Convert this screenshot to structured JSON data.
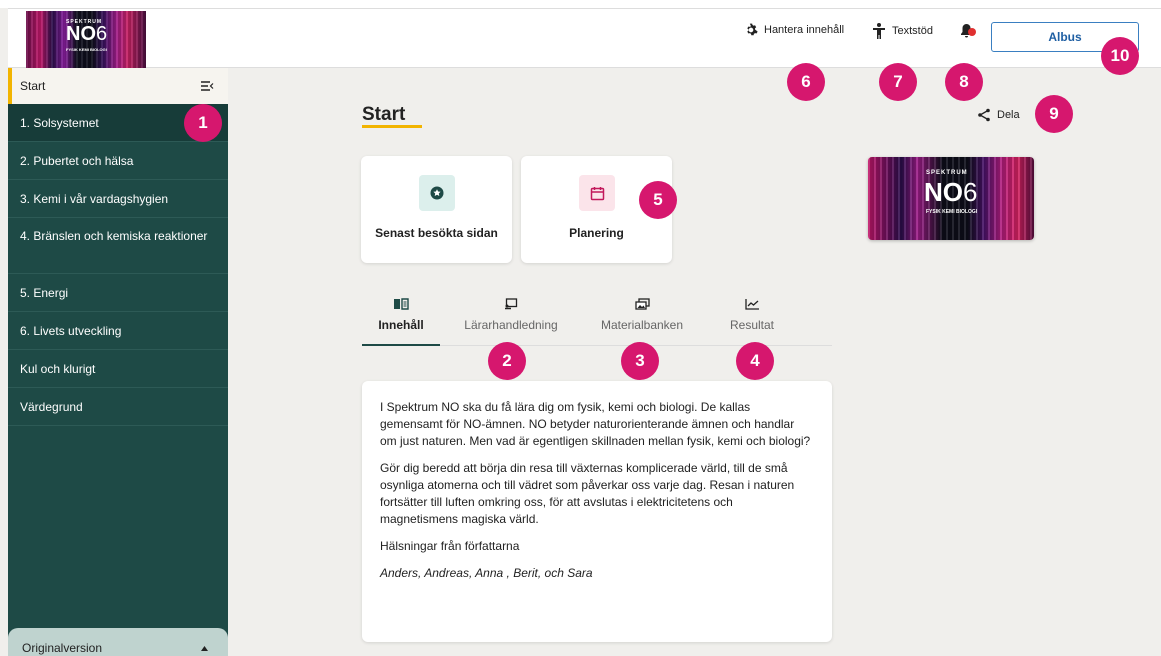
{
  "header": {
    "logo": {
      "small": "SPEKTRUM",
      "big": "NO",
      "num": "6",
      "sub": "FYSIK KEMI BIOLOGI"
    },
    "manage_label": "Hantera innehåll",
    "textsupport_label": "Textstöd",
    "user_label": "Albus"
  },
  "sidebar": {
    "start_label": "Start",
    "items": [
      {
        "label": "1. Solsystemet"
      },
      {
        "label": "2. Pubertet och hälsa"
      },
      {
        "label": "3. Kemi i vår vardagshygien"
      },
      {
        "label": "4. Bränslen och kemiska reaktioner"
      },
      {
        "label": "5. Energi"
      },
      {
        "label": "6. Livets utveckling"
      },
      {
        "label": "Kul och klurigt"
      },
      {
        "label": "Värdegrund"
      }
    ],
    "version_label": "Originalversion"
  },
  "main": {
    "title": "Start",
    "share_label": "Dela",
    "cards": [
      {
        "label": "Senast besökta sidan"
      },
      {
        "label": "Planering"
      }
    ],
    "cover": {
      "small": "SPEKTRUM",
      "big": "NO",
      "num": "6",
      "sub": "FYSIK KEMI BIOLOGI"
    },
    "tabs": [
      {
        "label": "Innehåll"
      },
      {
        "label": "Lärarhandledning"
      },
      {
        "label": "Materialbanken"
      },
      {
        "label": "Resultat"
      }
    ],
    "content": {
      "p1": "I Spektrum NO ska du få lära dig om fysik, kemi och biologi. De kallas gemensamt för NO-ämnen. NO betyder naturorienterande ämnen och handlar om just naturen. Men vad är egentligen skillnaden mellan fysik, kemi och biologi?",
      "p2": "Gör dig beredd att börja din resa till växternas komplicerade värld, till de små osynliga atomerna och till vädret som påverkar oss varje dag. Resan i naturen fortsätter till luften omkring oss, för att avslutas i elektricitetens och magnetismens magiska värld.",
      "p3": "Hälsningar från författarna",
      "authors": "Anders, Andreas, Anna , Berit, och Sara"
    }
  },
  "badges": [
    "1",
    "2",
    "3",
    "4",
    "5",
    "6",
    "7",
    "8",
    "9",
    "10"
  ],
  "colors": {
    "accent": "#f2b400",
    "sidebar": "#1e4a46",
    "badge": "#d6176e",
    "link": "#1f5fa3"
  }
}
